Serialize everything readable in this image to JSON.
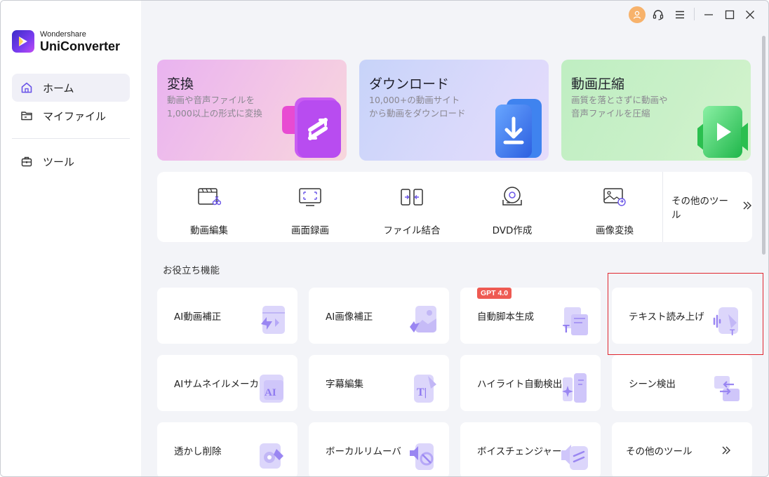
{
  "app": {
    "brand_small": "Wondershare",
    "brand_name": "UniConverter"
  },
  "sidebar": {
    "items": [
      {
        "label": "ホーム",
        "icon": "home-icon",
        "active": true
      },
      {
        "label": "マイファイル",
        "icon": "folder-icon"
      },
      {
        "label": "ツール",
        "icon": "toolbox-icon"
      }
    ]
  },
  "features": [
    {
      "title": "変換",
      "desc": "動画や音声ファイルを1,000以上の形式に変換",
      "icon": "convert-icon"
    },
    {
      "title": "ダウンロード",
      "desc": "10,000+の動画サイトから動画をダウンロード",
      "icon": "download-icon"
    },
    {
      "title": "動画圧縮",
      "desc": "画質を落とさずに動画や音声ファイルを圧縮",
      "icon": "compress-icon"
    }
  ],
  "tools": [
    {
      "label": "動画編集",
      "icon": "video-edit-icon"
    },
    {
      "label": "画面録画",
      "icon": "screen-record-icon"
    },
    {
      "label": "ファイル結合",
      "icon": "merge-icon"
    },
    {
      "label": "DVD作成",
      "icon": "dvd-icon"
    },
    {
      "label": "画像変換",
      "icon": "image-convert-icon"
    }
  ],
  "more_tools_label": "その他のツール",
  "section_title": "お役立ち機能",
  "grid": [
    {
      "label": "AI動画補正",
      "icon": "ai-video-enhance-icon"
    },
    {
      "label": "AI画像補正",
      "icon": "ai-image-enhance-icon"
    },
    {
      "label": "自動脚本生成",
      "icon": "script-gen-icon",
      "badge": "GPT 4.0"
    },
    {
      "label": "テキスト読み上げ",
      "icon": "text-to-speech-icon"
    },
    {
      "label": "AIサムネイルメーカー",
      "icon": "ai-thumbnail-icon"
    },
    {
      "label": "字幕編集",
      "icon": "subtitle-icon"
    },
    {
      "label": "ハイライト自動検出",
      "icon": "highlight-detect-icon"
    },
    {
      "label": "シーン検出",
      "icon": "scene-detect-icon"
    },
    {
      "label": "透かし削除",
      "icon": "watermark-remove-icon"
    },
    {
      "label": "ボーカルリムーバ",
      "icon": "vocal-remover-icon"
    },
    {
      "label": "ボイスチェンジャー",
      "icon": "voice-changer-icon"
    },
    {
      "label": "その他のツール",
      "icon": "chevron-right-double-icon"
    }
  ],
  "colors": {
    "accent": "#7a5cf0",
    "highlight_border": "#e0262f",
    "badge": "#ee5a52"
  }
}
